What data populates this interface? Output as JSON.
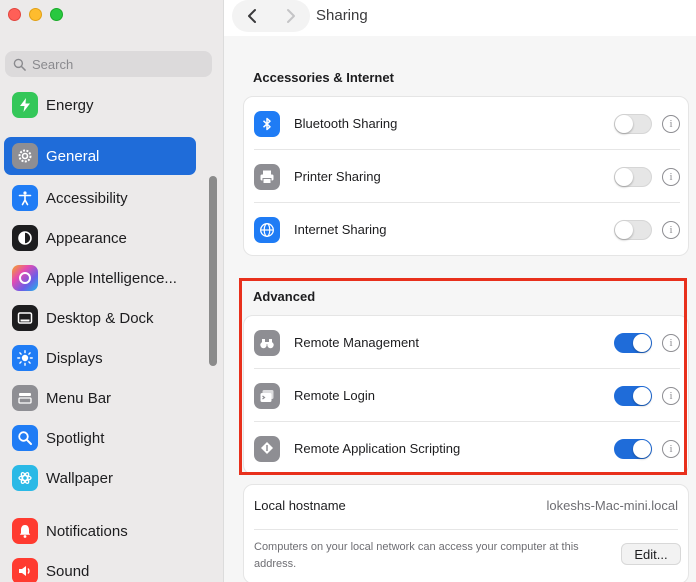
{
  "window": {
    "title": "Sharing"
  },
  "search": {
    "placeholder": "Search"
  },
  "sidebar": {
    "items": [
      {
        "label": "Energy",
        "icon": "bolt-icon",
        "color": "#34c759",
        "active": false
      },
      {
        "label": "General",
        "icon": "gear-icon",
        "color": "#8e8e93",
        "active": true
      },
      {
        "label": "Accessibility",
        "icon": "accessibility-icon",
        "color": "#1f7cf5",
        "active": false
      },
      {
        "label": "Appearance",
        "icon": "appearance-icon",
        "color": "#1d1d1f",
        "active": false
      },
      {
        "label": "Apple Intelligence...",
        "icon": "apple-intelligence-icon",
        "color": "#d66bd6",
        "active": false
      },
      {
        "label": "Desktop & Dock",
        "icon": "dock-icon",
        "color": "#1d1d1f",
        "active": false
      },
      {
        "label": "Displays",
        "icon": "sun-icon",
        "color": "#1f7cf5",
        "active": false
      },
      {
        "label": "Menu Bar",
        "icon": "menubar-icon",
        "color": "#8e8e93",
        "active": false
      },
      {
        "label": "Spotlight",
        "icon": "spotlight-icon",
        "color": "#1f7cf5",
        "active": false
      },
      {
        "label": "Wallpaper",
        "icon": "wallpaper-icon",
        "color": "#2ab9e6",
        "active": false
      },
      {
        "label": "Notifications",
        "icon": "bell-icon",
        "color": "#ff3b30",
        "active": false
      },
      {
        "label": "Sound",
        "icon": "speaker-icon",
        "color": "#ff3b30",
        "active": false
      }
    ]
  },
  "accessories": {
    "title": "Accessories & Internet",
    "rows": [
      {
        "label": "Bluetooth Sharing",
        "icon": "bluetooth-icon",
        "on": false
      },
      {
        "label": "Printer Sharing",
        "icon": "printer-icon",
        "on": false
      },
      {
        "label": "Internet Sharing",
        "icon": "globe-icon",
        "on": false
      }
    ]
  },
  "advanced": {
    "title": "Advanced",
    "rows": [
      {
        "label": "Remote Management",
        "icon": "binoculars-icon",
        "on": true
      },
      {
        "label": "Remote Login",
        "icon": "terminal-icon",
        "on": true
      },
      {
        "label": "Remote Application Scripting",
        "icon": "script-icon",
        "on": true
      }
    ]
  },
  "hostname": {
    "label": "Local hostname",
    "value": "lokeshs-Mac-mini.local",
    "description": "Computers on your local network can access your computer at this address.",
    "edit_label": "Edit..."
  },
  "colors": {
    "accent": "#1f6cd9",
    "highlight": "#e8301c"
  }
}
